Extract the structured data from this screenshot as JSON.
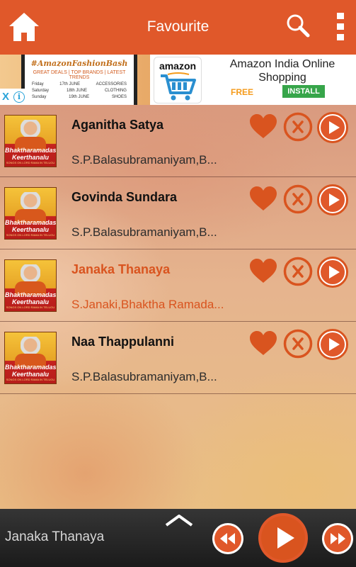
{
  "header": {
    "title": "Favourite",
    "home_icon": "home-icon",
    "search_icon": "search-icon",
    "menu_icon": "more-vert-icon",
    "color": "#e0582a"
  },
  "ad": {
    "poster_brand": "#AmazonFashionBash",
    "poster_sub": "GREAT DEALS | TOP BRANDS | LATEST TRENDS",
    "poster_rows": [
      {
        "day": "Friday",
        "date": "17th JUNE",
        "cat": "ACCESSORIES"
      },
      {
        "day": "Saturday",
        "date": "18th JUNE",
        "cat": "CLOTHING"
      },
      {
        "day": "Sunday",
        "date": "19th JUNE",
        "cat": "SHOES"
      }
    ],
    "logo_word": "amazon",
    "title": "Amazon India Online Shopping",
    "free": "FREE",
    "install": "INSTALL",
    "close_symbol": "X",
    "info_symbol": "i"
  },
  "album_thumb": {
    "line1": "Bhaktharamadasu",
    "line2": "Keerthanalu",
    "tagline": "SONGS ON LORD RAMA IN TELUGU",
    "label": "TIMES MUSIC"
  },
  "songs": [
    {
      "title": "Aganitha Satya",
      "artist": "S.P.Balasubramaniyam,B...",
      "active": false
    },
    {
      "title": "Govinda Sundara",
      "artist": "S.P.Balasubramaniyam,B...",
      "active": false
    },
    {
      "title": "Janaka Thanaya",
      "artist": "S.Janaki,Bhaktha Ramada...",
      "active": true
    },
    {
      "title": "Naa Thappulanni",
      "artist": "S.P.Balasubramaniyam,B...",
      "active": false
    }
  ],
  "player": {
    "now_playing": "Janaka Thanaya",
    "accent": "#d9541f"
  }
}
